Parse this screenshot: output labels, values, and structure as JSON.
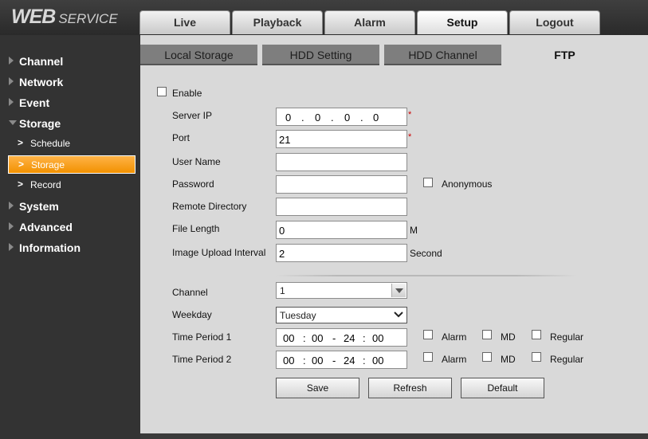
{
  "logo": {
    "main": "WEB",
    "sub": "SERVICE"
  },
  "main_tabs": [
    {
      "label": "Live",
      "active": false
    },
    {
      "label": "Playback",
      "active": false
    },
    {
      "label": "Alarm",
      "active": false
    },
    {
      "label": "Setup",
      "active": true
    },
    {
      "label": "Logout",
      "active": false
    }
  ],
  "sidebar": {
    "items": [
      {
        "label": "Channel",
        "expanded": false
      },
      {
        "label": "Network",
        "expanded": false
      },
      {
        "label": "Event",
        "expanded": false
      },
      {
        "label": "Storage",
        "expanded": true
      },
      {
        "label": "System",
        "expanded": false
      },
      {
        "label": "Advanced",
        "expanded": false
      },
      {
        "label": "Information",
        "expanded": false
      }
    ],
    "storage_sub": [
      {
        "label": "Schedule",
        "active": false
      },
      {
        "label": "Storage",
        "active": true
      },
      {
        "label": "Record",
        "active": false
      }
    ]
  },
  "sub_tabs": [
    {
      "label": "Local Storage",
      "active": false
    },
    {
      "label": "HDD Setting",
      "active": false
    },
    {
      "label": "HDD Channel",
      "active": false
    },
    {
      "label": "FTP",
      "active": true
    }
  ],
  "form": {
    "enable_label": "Enable",
    "enable_checked": false,
    "server_ip_label": "Server IP",
    "server_ip": [
      "0",
      "0",
      "0",
      "0"
    ],
    "port_label": "Port",
    "port_value": "21",
    "required_mark": "*",
    "username_label": "User Name",
    "username_value": "",
    "password_label": "Password",
    "password_value": "",
    "anonymous_label": "Anonymous",
    "anonymous_checked": false,
    "remote_dir_label": "Remote Directory",
    "remote_dir_value": "",
    "file_length_label": "File Length",
    "file_length_value": "0",
    "file_length_unit": "M",
    "upload_interval_label": "Image Upload Interval",
    "upload_interval_value": "2",
    "upload_interval_unit": "Second",
    "channel_label": "Channel",
    "channel_value": "1",
    "weekday_label": "Weekday",
    "weekday_value": "Tuesday",
    "periods": [
      {
        "label": "Time Period 1",
        "start_h": "00",
        "start_m": "00",
        "end_h": "24",
        "end_m": "00"
      },
      {
        "label": "Time Period 2",
        "start_h": "00",
        "start_m": "00",
        "end_h": "24",
        "end_m": "00"
      }
    ],
    "period_options": {
      "alarm": "Alarm",
      "md": "MD",
      "regular": "Regular"
    },
    "time_sep": ":",
    "range_sep": "-",
    "ip_sep": "."
  },
  "buttons": {
    "save": "Save",
    "refresh": "Refresh",
    "default": "Default"
  },
  "colors": {
    "active_sidebar": "#f29100",
    "required": "#cc0000"
  }
}
